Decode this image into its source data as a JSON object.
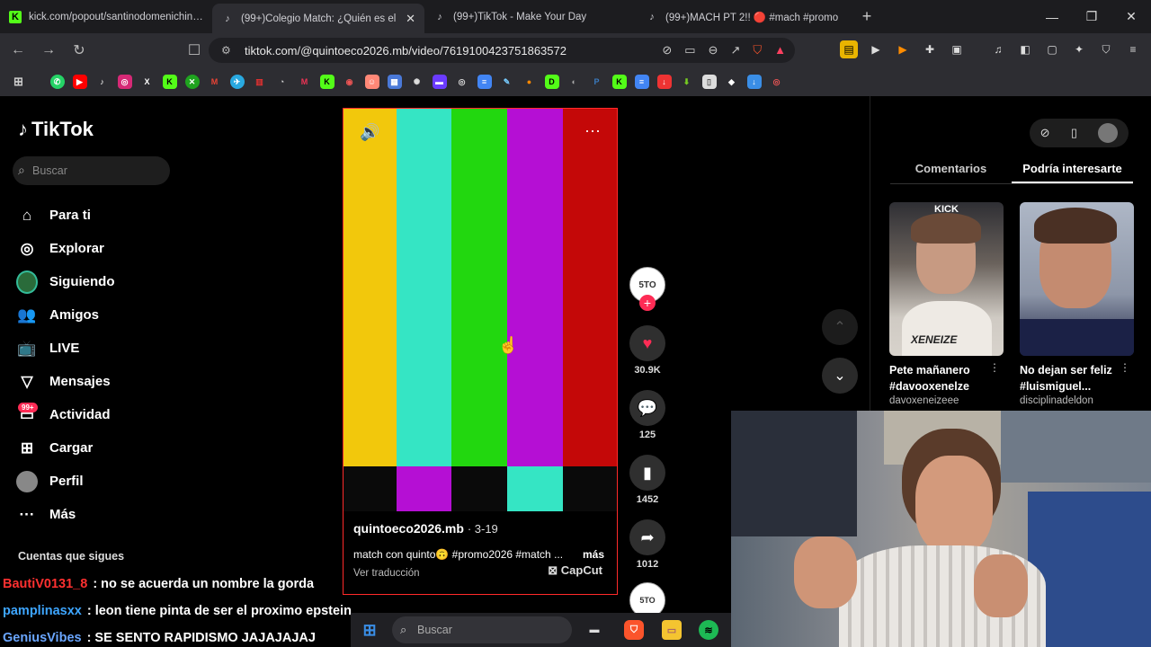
{
  "browser": {
    "tabs": [
      {
        "label": "kick.com/popout/santinodomenichini/chat",
        "favicon": "kick-icon"
      },
      {
        "label": "(99+)Colegio Match: ¿Quién es el",
        "favicon": "tiktok-icon"
      },
      {
        "label": "(99+)TikTok - Make Your Day",
        "favicon": "tiktok-icon"
      },
      {
        "label": "(99+)MACH PT 2!! 🔴 #mach #promo",
        "favicon": "tiktok-icon"
      }
    ],
    "url": "tiktok.com/@quintoeco2026.mb/video/7619100423751863572"
  },
  "sidebar": {
    "logo": "TikTok",
    "search_placeholder": "Buscar",
    "items": [
      {
        "label": "Para ti",
        "icon": "home-icon"
      },
      {
        "label": "Explorar",
        "icon": "compass-icon"
      },
      {
        "label": "Siguiendo",
        "icon": "following-avatar-icon"
      },
      {
        "label": "Amigos",
        "icon": "friends-icon"
      },
      {
        "label": "LIVE",
        "icon": "live-icon"
      },
      {
        "label": "Mensajes",
        "icon": "send-icon"
      },
      {
        "label": "Actividad",
        "icon": "activity-icon",
        "badge": "99+"
      },
      {
        "label": "Cargar",
        "icon": "upload-icon"
      },
      {
        "label": "Perfil",
        "icon": "profile-avatar-icon"
      },
      {
        "label": "Más",
        "icon": "more-icon"
      }
    ],
    "following_header": "Cuentas que sigues"
  },
  "video": {
    "username": "quintoeco2026.mb",
    "date": "· 3-19",
    "description": "match con quinto🙃 #promo2026 #match ...",
    "more": "más",
    "translation": "Ver traducción",
    "watermark": "CapCut",
    "bar_colors": [
      "#f2c80c",
      "#35e5c4",
      "#22d70f",
      "#b50fd4",
      "#c40808"
    ],
    "lower_colors": [
      "#0a0a0a",
      "#b50fd4",
      "#0a0a0a",
      "#35e5c4",
      "#0a0a0a"
    ]
  },
  "actions": {
    "avatar_text": "5TO",
    "likes": "30.9K",
    "comments": "125",
    "saves": "1452",
    "shares": "1012"
  },
  "right_panel": {
    "tabs": [
      "Comentarios",
      "Podría interesarte"
    ],
    "cards": [
      {
        "title": "Pete mañanero #davooxenelze",
        "author": "davoxeneizeee",
        "overlay_top": "KICK",
        "overlay_bottom": "XENEIZE"
      },
      {
        "title": "No dejan ser feliz #luismiguel...",
        "author": "disciplinadeldon"
      }
    ]
  },
  "chat": [
    {
      "user": "BautiV0131_8",
      "text": ": no se acuerda un nombre la gorda"
    },
    {
      "user": "pamplinasxx",
      "text": ": leon tiene pinta de ser el proximo epstein"
    },
    {
      "user": "GeniusVibes",
      "text": ": SE SENTO RAPIDISMO JAJAJAJAJ"
    }
  ],
  "taskbar": {
    "search_placeholder": "Buscar"
  }
}
